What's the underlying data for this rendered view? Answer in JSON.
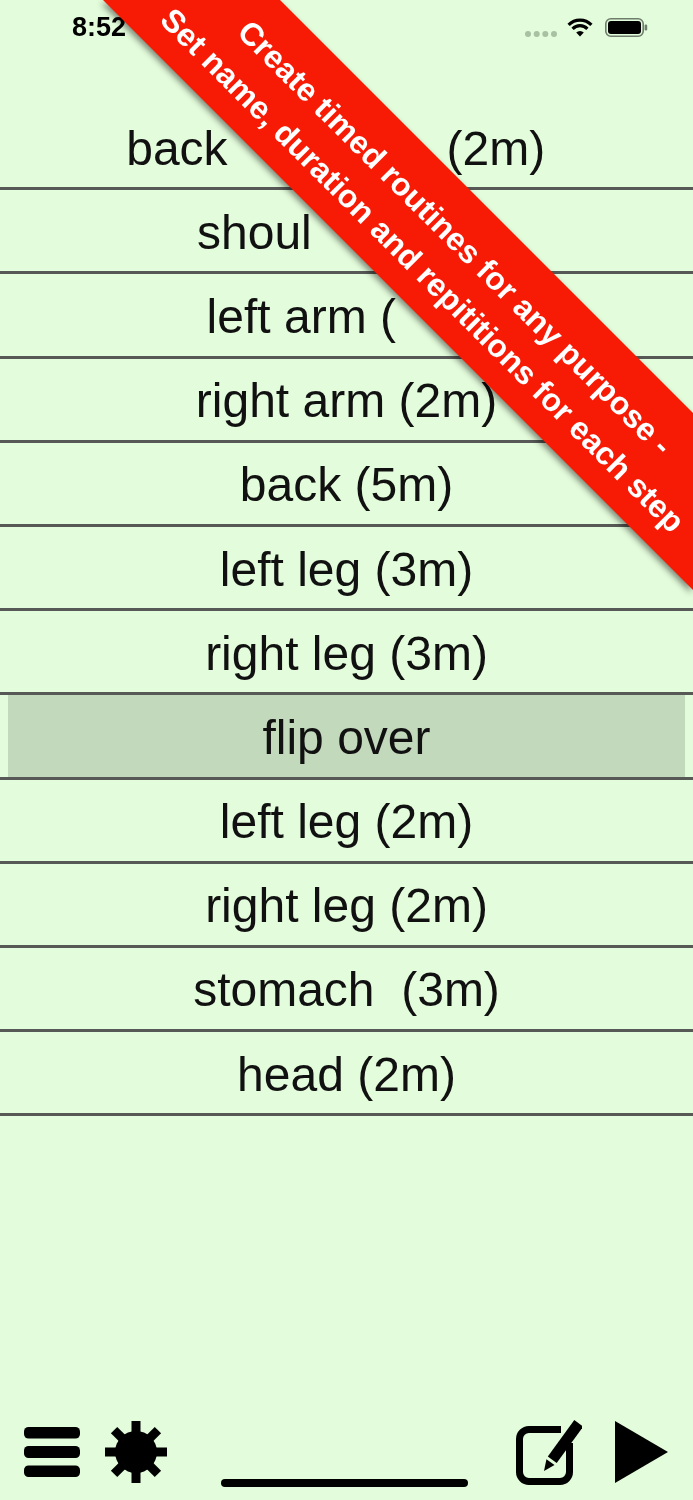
{
  "status_bar": {
    "time": "8:52"
  },
  "banner": {
    "lines": [
      "Create timed routines for any purpose -",
      "Set name, duration and repititions for each step"
    ]
  },
  "steps": [
    {
      "kind": "covered",
      "text_before": "back",
      "text_after": "(2m)",
      "selected": false
    },
    {
      "kind": "covered",
      "text_before": "shoul",
      "selected": false
    },
    {
      "kind": "covered",
      "text_before": "left arm (",
      "selected": false
    },
    {
      "kind": "plain",
      "label": "right arm (2m)",
      "selected": false
    },
    {
      "kind": "plain",
      "label": "back (5m)",
      "selected": false
    },
    {
      "kind": "plain",
      "label": "left leg (3m)",
      "selected": false
    },
    {
      "kind": "plain",
      "label": "right leg (3m)",
      "selected": false
    },
    {
      "kind": "plain",
      "label": "flip over",
      "selected": true
    },
    {
      "kind": "plain",
      "label": "left leg (2m)",
      "selected": false
    },
    {
      "kind": "plain",
      "label": "right leg (2m)",
      "selected": false
    },
    {
      "kind": "plain",
      "label": "stomach  (3m)",
      "selected": false
    },
    {
      "kind": "plain",
      "label": "head (2m)",
      "selected": false
    }
  ]
}
